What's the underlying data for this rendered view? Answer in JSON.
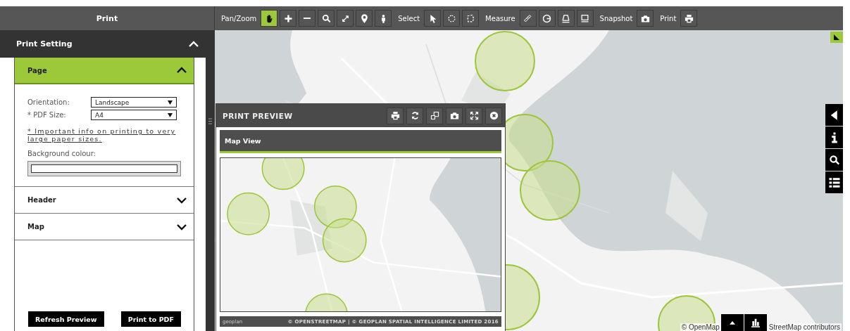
{
  "sidebar": {
    "title": "Print",
    "section": {
      "title": "Print Setting",
      "expanded": true
    },
    "panels": [
      {
        "title": "Page",
        "expanded": true
      },
      {
        "title": "Header",
        "expanded": false
      },
      {
        "title": "Map",
        "expanded": false
      }
    ],
    "page": {
      "fields": [
        {
          "label": "Orientation:",
          "value": "Landscape"
        },
        {
          "label": "* PDF Size:",
          "value": "A4"
        }
      ],
      "info_link": "* Important info on printing to very large paper sizes.",
      "background_label": "Background colour:"
    },
    "buttons": [
      "Refresh Preview",
      "Print to PDF"
    ]
  },
  "toolbar": {
    "groups": [
      {
        "label": "Pan/Zoom",
        "tools": [
          {
            "kind": "hand",
            "selected": true
          },
          {
            "kind": "plus",
            "selected": false
          },
          {
            "kind": "minus",
            "selected": false
          },
          {
            "kind": "search",
            "selected": false
          },
          {
            "kind": "expand",
            "selected": false
          },
          {
            "kind": "pin",
            "selected": false
          },
          {
            "kind": "person",
            "selected": false
          }
        ]
      },
      {
        "label": "Select",
        "tools": [
          {
            "kind": "pointer",
            "selected": false
          },
          {
            "kind": "circle-select",
            "selected": false
          },
          {
            "kind": "polygon-select",
            "selected": false
          }
        ]
      },
      {
        "label": "Measure",
        "tools": [
          {
            "kind": "ruler",
            "selected": false
          },
          {
            "kind": "radius",
            "selected": false
          },
          {
            "kind": "area",
            "selected": false
          },
          {
            "kind": "screen",
            "selected": false
          }
        ]
      },
      {
        "label": "Snapshot",
        "tools": [
          {
            "kind": "camera",
            "selected": false
          }
        ]
      },
      {
        "label": "Print",
        "tools": [
          {
            "kind": "printer",
            "selected": false
          }
        ]
      }
    ]
  },
  "preview": {
    "title": "PRINT PREVIEW",
    "tools": [
      {
        "kind": "printer"
      },
      {
        "kind": "refresh"
      },
      {
        "kind": "resize"
      },
      {
        "kind": "camera"
      },
      {
        "kind": "fullscreen"
      },
      {
        "kind": "close"
      }
    ],
    "heading": "Map View",
    "footer_left": "geoplan",
    "footer_right": "© OPENSTREETMAP | © GEOPLAN SPATIAL INTELLIGENCE LIMITED 2016"
  },
  "map": {
    "side_tools": [
      {
        "kind": "collapse"
      },
      {
        "kind": "info"
      },
      {
        "kind": "search"
      },
      {
        "kind": "list"
      }
    ],
    "bottom_tools": [
      {
        "kind": "up"
      },
      {
        "kind": "chart"
      }
    ],
    "attribution_left": "© OpenMap",
    "attribution_right": "StreetMap contributors"
  }
}
